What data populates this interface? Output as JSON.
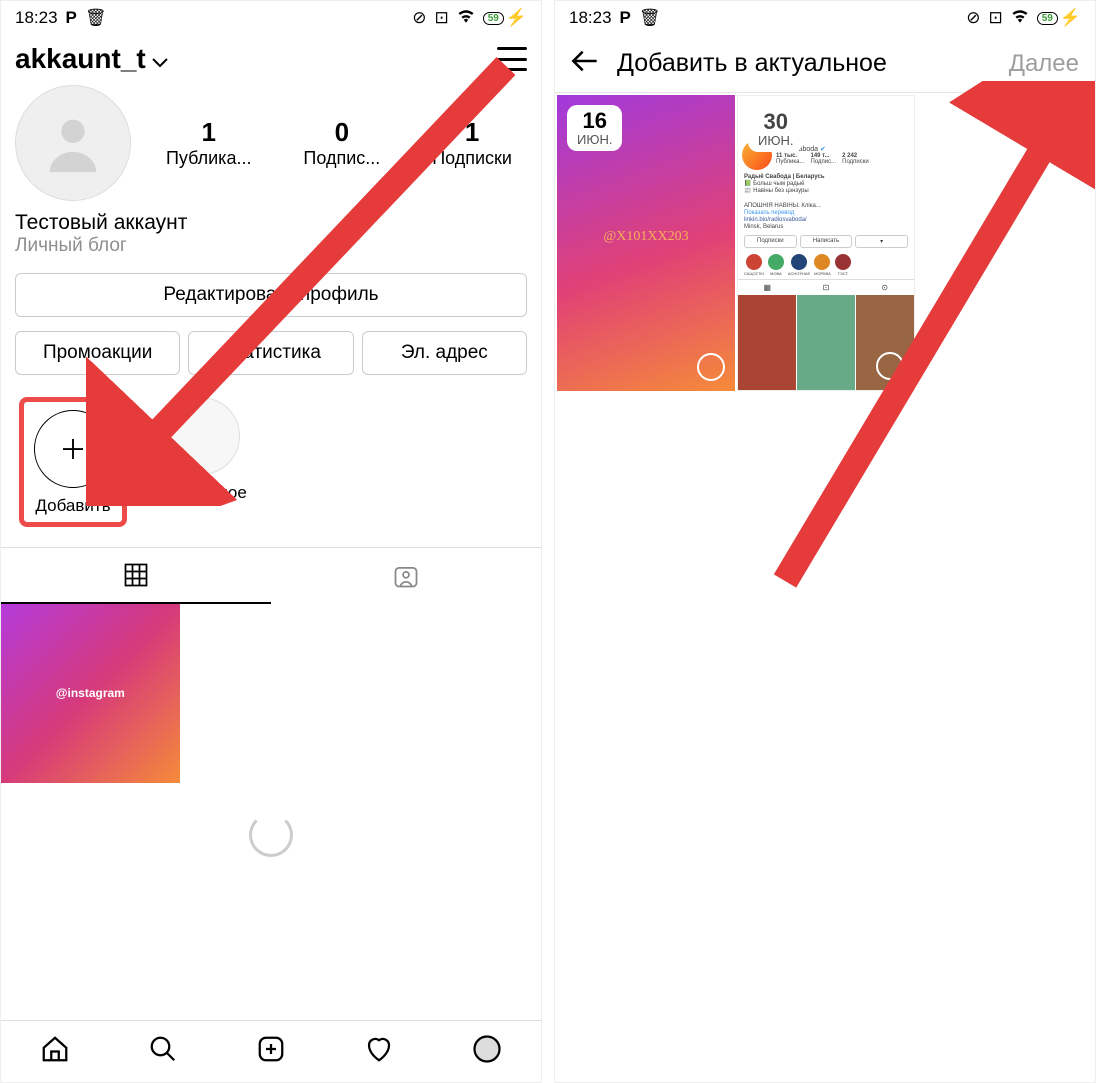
{
  "status": {
    "time": "18:23",
    "battery": "59"
  },
  "left": {
    "username": "akkaunt_t",
    "stats": {
      "posts": {
        "value": "1",
        "label": "Публика..."
      },
      "followers": {
        "value": "0",
        "label": "Подпис..."
      },
      "following": {
        "value": "1",
        "label": "Подписки"
      }
    },
    "bio": {
      "name": "Тестовый аккаунт",
      "category": "Личный блог"
    },
    "buttons": {
      "edit": "Редактировать профиль",
      "promo": "Промоакции",
      "stats": "Статистика",
      "email": "Эл. адрес"
    },
    "highlights": {
      "add": "Добавить",
      "item1": "Актуальное"
    },
    "post_tag": "@instagram"
  },
  "right": {
    "title": "Добавить в актуальное",
    "next": "Далее",
    "story1": {
      "date_num": "16",
      "date_mon": "ИЮН.",
      "tag": "@X101XX203"
    },
    "story2": {
      "date_num": "30",
      "date_mon": "ИЮН.",
      "account": "radiosvaboda",
      "s1": "11 тыс.",
      "s2": "149 т...",
      "s3": "2 242",
      "s1l": "Публика...",
      "s2l": "Подпис...",
      "s3l": "Подписки",
      "bio1": "Радыё Свабода | Беларусь",
      "bio2": "📗 Больш чым радыё",
      "bio3": "📰 Навіны без цэнзуры",
      "bio4": "АПОШНІЯ НАВІНЫ. Кліка...",
      "bio5": "Показать перевод",
      "bio6": "linkin.bio/radiosvaboda/",
      "bio7": "Minsk, Belarus",
      "btn1": "Подписки",
      "btn2": "Написать",
      "hl": [
        "САЦСЕТКІ",
        "МОВА",
        "АСНОЎНАЕ",
        "МОРКВА",
        "ТЭСТ"
      ]
    }
  }
}
